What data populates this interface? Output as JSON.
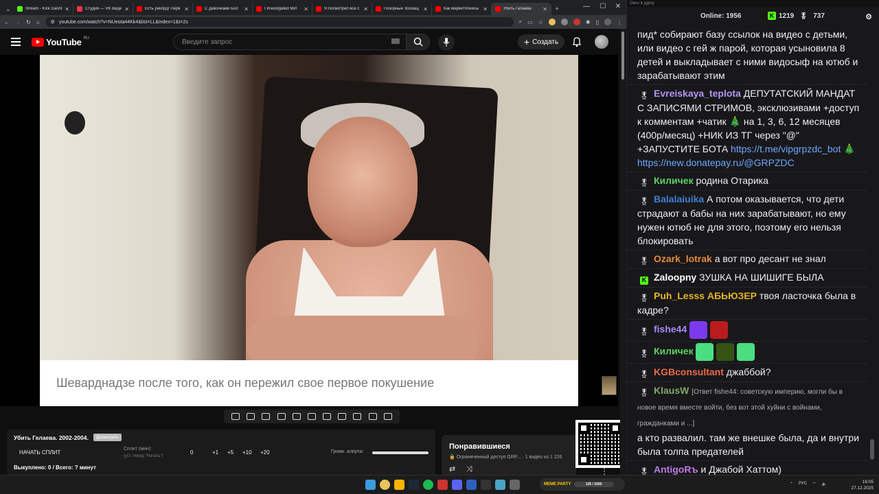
{
  "browser": {
    "tabs": [
      {
        "label": "Stream - Kick Dashboa",
        "color": "#53fc18"
      },
      {
        "label": "Студия — VK Видео",
        "color": "#ff3347"
      },
      {
        "label": "Есть рекорд! Перв",
        "color": "#ff0000"
      },
      {
        "label": "С Девочками Бол",
        "color": "#ff0000"
      },
      {
        "label": "I Investigated Mirr",
        "color": "#ff0000"
      },
      {
        "label": "Я посмотрел все с",
        "color": "#ff0000"
      },
      {
        "label": "Позорные Зоозащ",
        "color": "#ff0000"
      },
      {
        "label": "Как маркетплейсы",
        "color": "#ff0000"
      },
      {
        "label": "Убить Гелаева",
        "color": "#ff0000"
      }
    ],
    "url": "youtube.com/watch?v=NUeota44Kk4&list=LL&index=1&t=2s",
    "new_tab": "+"
  },
  "youtube": {
    "logo_text": "YouTube",
    "logo_region": "RU",
    "search_placeholder": "Введите запрос",
    "create_label": "Создать",
    "video_caption": "Шеварднадзе после того, как он пережил свое первое покушение"
  },
  "split": {
    "title": "Убить Гелаева. 2002-2004.",
    "badge": "Досмотреть",
    "start_button": "НАЧАТЬ СПЛИТ",
    "split_label": "Сплит (мин):",
    "split_hint": "(уст. перед \"Начать\")",
    "steps": [
      "0",
      "+1",
      "+5",
      "+10",
      "+20"
    ],
    "alert_label": "Громк. алерта:",
    "alert_volume": 1.0,
    "footer": "Выкуплено: 0 / Всего: ? минут"
  },
  "liked": {
    "title": "Понравившиеся",
    "subtitle": "Ограниченный доступ GRP... · 1 видео из 1 226"
  },
  "chat": {
    "window_title": "Окно в дурку",
    "online_label": "Online:",
    "online_count": "1956",
    "kick_count": "1219",
    "mod_count": "737",
    "messages": [
      {
        "user": "",
        "text": "пид* собирают базу ссылок на видео с детьми, или видео с гей ж парой, которая усыновила 8 детей и выкладывает с ними видосыф на ютюб и зарабатывают этим",
        "color": "#efeff1"
      },
      {
        "user": "Evreiskaya_teplota",
        "text": "ДЕПУТАТСКИЙ МАНДАТ С ЗАПИСЯМИ СТРИМОВ, эксклюзивами +доступ к комментам +чатик 🎄 на 1, 3, 6, 12 месяцев (400р/месяц) +НИК ИЗ ТГ через \"@\" +ЗАПУСТИТЕ БОТА",
        "link1": "https://t.me/vipgrpzdc_bot",
        "link2": "https://new.donatepay.ru/@GRPZDC",
        "color": "#b794f4"
      },
      {
        "user": "Киличек",
        "text": "родина Отарика",
        "color": "#5fd068"
      },
      {
        "user": "Balalaiuika",
        "text": "А потом оказывается, что дети страдают а бабы на них зарабатывают, но ему нужен ютюб не для этого, поэтому его нельзя блокировать",
        "color": "#3f7fd1"
      },
      {
        "user": "Ozark_lotrak",
        "text": "а вот про десант не знал",
        "color": "#e88a3a"
      },
      {
        "user": "Zaloopny",
        "text": "ЗУШКА НА ШИШИГЕ БЫЛА",
        "color": "#ffffff"
      },
      {
        "user": "Puh_Lesss",
        "user2": "АБЬЮЗЕР",
        "text": "твоя ласточка была в кадре?",
        "color": "#e6b325"
      },
      {
        "user": "fishe44",
        "text": "",
        "color": "#a78bfa"
      },
      {
        "user": "Киличек",
        "text": "",
        "color": "#5fd068"
      },
      {
        "user": "KGBconsultant",
        "text": "джаббой?",
        "color": "#e86a4a"
      },
      {
        "user": "KlausW",
        "reply": "[Ответ fishe44: советскую империю, могли бы в новое время вместе войти, без вот этой хуйни с войнами, гражданками и ...]",
        "text": "а кто развалил. там же внешке была, да и внутри была толпа предателей",
        "color": "#7fa86a"
      },
      {
        "user": "AntigoRъ",
        "text": "и Джабой Хаттом)",
        "color": "#c07ae8"
      }
    ]
  },
  "taskbar": {
    "meme_label": "MEME PARTY",
    "meme_progress": "135 / 1500",
    "lang": "РУС",
    "time": "16:05",
    "date": "27.12.2025"
  }
}
